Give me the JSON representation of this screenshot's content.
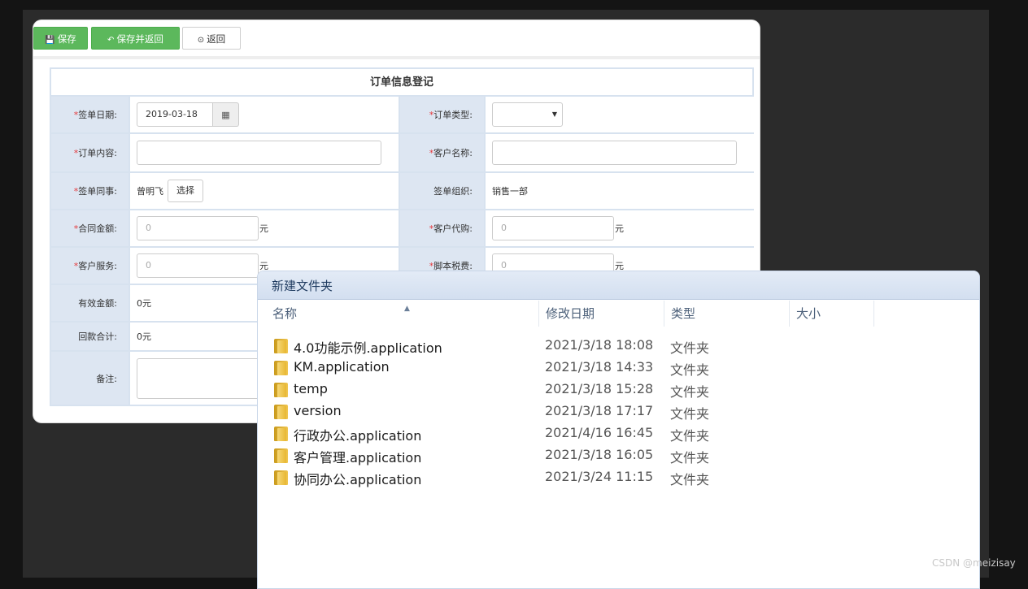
{
  "toolbar": {
    "save_label": "保存",
    "save_return_label": "保存并返回",
    "back_label": "返回"
  },
  "form": {
    "title": "订单信息登记",
    "rows": [
      {
        "left_label": "签单日期:",
        "left_required": true,
        "left_value": "2019-03-18",
        "right_label": "订单类型:",
        "right_required": true,
        "right_value": ""
      },
      {
        "left_label": "订单内容:",
        "left_required": true,
        "left_value": "",
        "right_label": "客户名称:",
        "right_required": true,
        "right_value": ""
      },
      {
        "left_label": "签单同事:",
        "left_required": true,
        "left_value": "曾明飞",
        "left_button": "选择",
        "right_label": "签单组织:",
        "right_required": false,
        "right_value": "销售一部"
      },
      {
        "left_label": "合同金额:",
        "left_required": true,
        "left_value": "0",
        "left_unit": "元",
        "right_label": "客户代购:",
        "right_required": true,
        "right_value": "0",
        "right_unit": "元"
      },
      {
        "left_label": "客户服务:",
        "left_required": true,
        "left_value": "0",
        "left_unit": "元",
        "right_label": "脚本税费:",
        "right_required": true,
        "right_value": "0",
        "right_unit": "元"
      },
      {
        "left_label": "有效金额:",
        "left_required": false,
        "left_value": "0元"
      },
      {
        "left_label": "回款合计:",
        "left_required": false,
        "left_value": "0元"
      },
      {
        "left_label": "备注:",
        "left_required": false,
        "left_value": ""
      }
    ]
  },
  "explorer": {
    "title": "新建文件夹",
    "columns": [
      "名称",
      "修改日期",
      "类型",
      "大小"
    ],
    "files": [
      {
        "name": "4.0功能示例.application",
        "date": "2021/3/18 18:08",
        "type": "文件夹"
      },
      {
        "name": "KM.application",
        "date": "2021/3/18 14:33",
        "type": "文件夹"
      },
      {
        "name": "temp",
        "date": "2021/3/18 15:28",
        "type": "文件夹"
      },
      {
        "name": "version",
        "date": "2021/3/18 17:17",
        "type": "文件夹"
      },
      {
        "name": "行政办公.application",
        "date": "2021/4/16 16:45",
        "type": "文件夹"
      },
      {
        "name": "客户管理.application",
        "date": "2021/3/18 16:05",
        "type": "文件夹"
      },
      {
        "name": "协同办公.application",
        "date": "2021/3/24 11:15",
        "type": "文件夹"
      }
    ]
  },
  "watermark": "CSDN @meizisay"
}
